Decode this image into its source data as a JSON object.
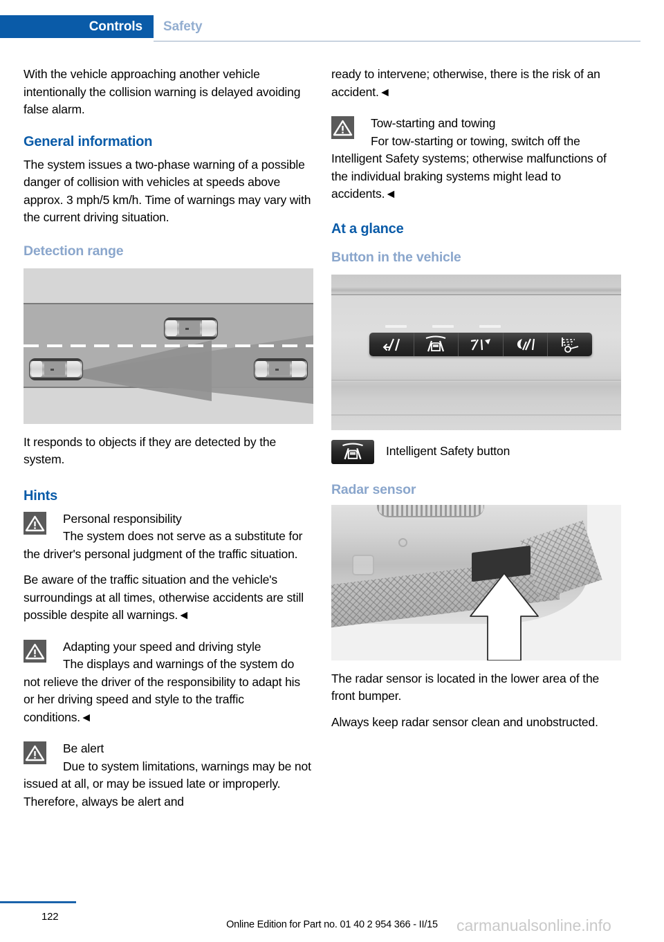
{
  "header": {
    "active_tab": "Controls",
    "inactive_tab": "Safety",
    "active_tab_color": "#0a5ba8",
    "inactive_tab_color": "#93aed0"
  },
  "left_column": {
    "intro_paragraph": "With the vehicle approaching another vehicle intentionally the collision warning is delayed avoiding false alarm.",
    "general_information_heading": "General information",
    "general_information_paragraph": "The system issues a two-phase warning of a possible danger of collision with vehicles at speeds above approx. 3 mph/5 km/h. Time of warnings may vary with the current driving situation.",
    "detection_range_heading": "Detection range",
    "detection_range_caption": "It responds to objects if they are detected by the system.",
    "hints_heading": "Hints",
    "warnings": [
      {
        "title": "Personal responsibility",
        "text": "The system does not serve as a substitute for the driver's personal judgment of the traffic situation.",
        "text2": "Be aware of the traffic situation and the vehicle's surroundings at all times, otherwise accidents are still possible despite all warnings.◄"
      },
      {
        "title": "Adapting your speed and driving style",
        "text": "The displays and warnings of the system do not relieve the driver of the responsibility to adapt his or her driving speed and style to the traffic conditions.◄"
      },
      {
        "title": "Be alert",
        "text": "Due to system limitations, warnings may be not issued at all, or may be issued late or improperly. Therefore, always be alert and"
      }
    ]
  },
  "right_column": {
    "continuation_paragraph": "ready to intervene; otherwise, there is the risk of an accident.◄",
    "warnings": [
      {
        "title": "Tow-starting and towing",
        "text": "For tow-starting or towing, switch off the Intelligent Safety systems; otherwise malfunctions of the individual braking systems might lead to accidents.◄"
      }
    ],
    "at_a_glance_heading": "At a glance",
    "button_in_vehicle_heading": "Button in the vehicle",
    "button_caption": "Intelligent Safety button",
    "radar_sensor_heading": "Radar sensor",
    "radar_paragraph_1": "The radar sensor is located in the lower area of the front bumper.",
    "radar_paragraph_2": "Always keep radar sensor clean and unobstructed."
  },
  "figures": {
    "detection_range": {
      "alt": "Top-down road diagram: three cars on a two-lane road with a radar detection cone emanating from the left vehicle",
      "car_count": 3
    },
    "button_panel": {
      "alt": "Dashboard panel with a row of five Intelligent Safety buttons",
      "button_count": 5,
      "button_icons": [
        "lane-departure-warning-icon",
        "intelligent-safety-icon",
        "lane-change-warning-icon",
        "night-vision-icon",
        "headlight-assist-icon"
      ]
    },
    "radar_sensor": {
      "alt": "Front bumper of the vehicle with a white arrow pointing at the radar sensor in the lower bumper area"
    }
  },
  "footer": {
    "page_number": "122",
    "edition_text": "Online Edition for Part no. 01 40 2 954 366 - II/15",
    "watermark": "carmanualsonline.info"
  }
}
